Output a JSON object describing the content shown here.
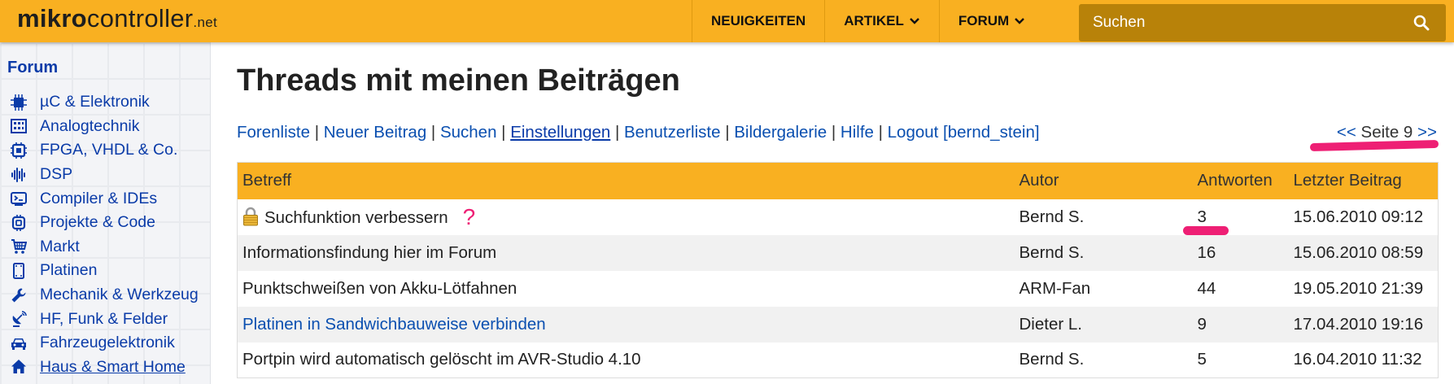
{
  "header": {
    "logo_bold": "mikro",
    "logo_regular": "controller",
    "logo_tld": ".net",
    "nav": [
      {
        "label": "NEUIGKEITEN",
        "dropdown": false
      },
      {
        "label": "ARTIKEL",
        "dropdown": true
      },
      {
        "label": "FORUM",
        "dropdown": true
      }
    ],
    "search_placeholder": "Suchen",
    "accent_color": "#f9b021"
  },
  "sidebar": {
    "title": "Forum",
    "items": [
      {
        "label": "µC & Elektronik",
        "icon": "chip-icon"
      },
      {
        "label": "Analogtechnik",
        "icon": "panel-icon"
      },
      {
        "label": "FPGA, VHDL & Co.",
        "icon": "fpga-icon"
      },
      {
        "label": "DSP",
        "icon": "waveform-icon"
      },
      {
        "label": "Compiler & IDEs",
        "icon": "terminal-icon"
      },
      {
        "label": "Projekte & Code",
        "icon": "processor-icon"
      },
      {
        "label": "Markt",
        "icon": "cart-icon"
      },
      {
        "label": "Platinen",
        "icon": "board-icon"
      },
      {
        "label": "Mechanik & Werkzeug",
        "icon": "wrench-icon"
      },
      {
        "label": "HF, Funk & Felder",
        "icon": "satellite-icon"
      },
      {
        "label": "Fahrzeugelektronik",
        "icon": "car-icon"
      },
      {
        "label": "Haus & Smart Home",
        "icon": "home-icon"
      }
    ]
  },
  "main": {
    "title": "Threads mit meinen Beiträgen",
    "links": [
      "Forenliste",
      "Neuer Beitrag",
      "Suchen",
      "Einstellungen",
      "Benutzerliste",
      "Bildergalerie",
      "Hilfe",
      "Logout [bernd_stein]"
    ],
    "pager": {
      "prev": "<<",
      "label": "Seite 9",
      "next": ">>"
    },
    "table": {
      "headers": [
        "Betreff",
        "Autor",
        "Antworten",
        "Letzter Beitrag"
      ],
      "rows": [
        {
          "subject": "Suchfunktion verbessern",
          "author": "Bernd S.",
          "replies": "3",
          "last": "15.06.2010 09:12",
          "locked": true,
          "annotation": "?"
        },
        {
          "subject": "Informationsfindung hier im Forum",
          "author": "Bernd S.",
          "replies": "16",
          "last": "15.06.2010 08:59"
        },
        {
          "subject": "Punktschweißen von Akku-Lötfahnen",
          "author": "ARM-Fan",
          "replies": "44",
          "last": "19.05.2010 21:39"
        },
        {
          "subject": "Platinen in Sandwichbauweise verbinden",
          "author": "Dieter L.",
          "replies": "9",
          "last": "17.04.2010 19:16",
          "visited": true
        },
        {
          "subject": "Portpin wird automatisch gelöscht im AVR-Studio 4.10",
          "author": "Bernd S.",
          "replies": "5",
          "last": "16.04.2010 11:32"
        }
      ]
    },
    "highlight_color": "#ee1f74"
  }
}
